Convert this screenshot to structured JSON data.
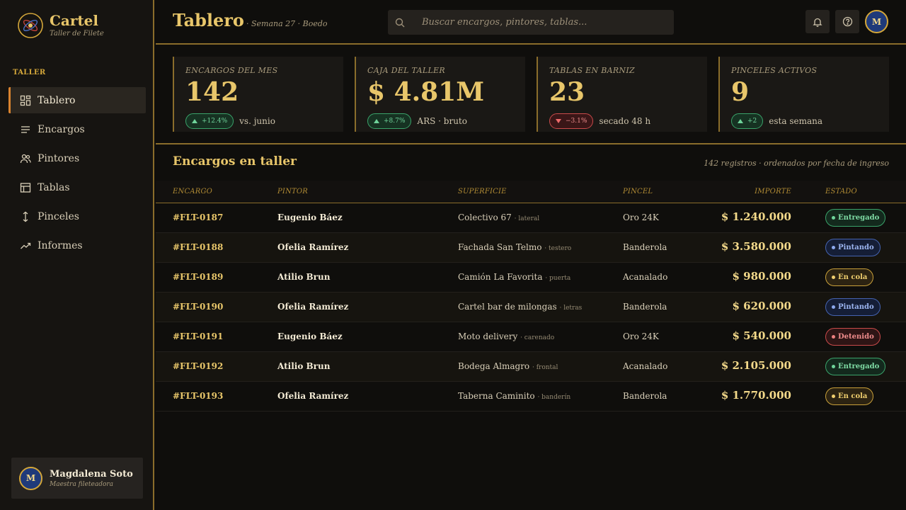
{
  "brand": {
    "name": "Cartel",
    "subtitle": "Taller de Filete"
  },
  "sidebar": {
    "section": "TALLER",
    "items": [
      {
        "label": "Tablero",
        "icon": "dashboard-icon",
        "active": true
      },
      {
        "label": "Encargos",
        "icon": "list-icon"
      },
      {
        "label": "Pintores",
        "icon": "users-icon"
      },
      {
        "label": "Tablas",
        "icon": "table-icon"
      },
      {
        "label": "Pinceles",
        "icon": "brush-icon"
      },
      {
        "label": "Informes",
        "icon": "trend-icon"
      }
    ],
    "user": {
      "initial": "M",
      "name": "Magdalena Soto",
      "role": "Maestra fileteadora"
    }
  },
  "header": {
    "title": "Tablero",
    "subtitle": "· Semana 27 · Boedo",
    "search_placeholder": "Buscar encargos, pintores, tablas...",
    "avatar_initial": "M"
  },
  "kpis": [
    {
      "label": "ENCARGOS DEL MES",
      "value": "142",
      "delta": "+12.4%",
      "direction": "up",
      "note": "vs. junio"
    },
    {
      "label": "CAJA DEL TALLER",
      "value": "$ 4.81M",
      "delta": "+8.7%",
      "direction": "up",
      "note": "ARS · bruto"
    },
    {
      "label": "TABLAS EN BARNIZ",
      "value": "23",
      "delta": "−3.1%",
      "direction": "down",
      "note": "secado 48 h"
    },
    {
      "label": "PINCELES ACTIVOS",
      "value": "9",
      "delta": "+2",
      "direction": "up",
      "note": "esta semana"
    }
  ],
  "table": {
    "title": "Encargos en taller",
    "meta": "142 registros · ordenados por fecha de ingreso",
    "columns": [
      "ENCARGO",
      "PINTOR",
      "SUPERFICIE",
      "PINCEL",
      "IMPORTE",
      "ESTADO"
    ],
    "rows": [
      {
        "id": "#FLT-0187",
        "painter": "Eugenio Báez",
        "surface": "Colectivo 67",
        "detail": "· lateral",
        "brush": "Oro 24K",
        "amount": "$ 1.240.000",
        "status": "Entregado",
        "status_kind": "ent"
      },
      {
        "id": "#FLT-0188",
        "painter": "Ofelia Ramírez",
        "surface": "Fachada San Telmo",
        "detail": "· testero",
        "brush": "Banderola",
        "amount": "$ 3.580.000",
        "status": "Pintando",
        "status_kind": "pin"
      },
      {
        "id": "#FLT-0189",
        "painter": "Atilio Brun",
        "surface": "Camión La Favorita",
        "detail": "· puerta",
        "brush": "Acanalado",
        "amount": "$ 980.000",
        "status": "En cola",
        "status_kind": "col"
      },
      {
        "id": "#FLT-0190",
        "painter": "Ofelia Ramírez",
        "surface": "Cartel bar de milongas",
        "detail": "· letras",
        "brush": "Banderola",
        "amount": "$ 620.000",
        "status": "Pintando",
        "status_kind": "pin"
      },
      {
        "id": "#FLT-0191",
        "painter": "Eugenio Báez",
        "surface": "Moto delivery",
        "detail": "· carenado",
        "brush": "Oro 24K",
        "amount": "$ 540.000",
        "status": "Detenido",
        "status_kind": "det"
      },
      {
        "id": "#FLT-0192",
        "painter": "Atilio Brun",
        "surface": "Bodega Almagro",
        "detail": "· frontal",
        "brush": "Acanalado",
        "amount": "$ 2.105.000",
        "status": "Entregado",
        "status_kind": "ent"
      },
      {
        "id": "#FLT-0193",
        "painter": "Ofelia Ramírez",
        "surface": "Taberna Caminito",
        "detail": "· banderín",
        "brush": "Banderola",
        "amount": "$ 1.770.000",
        "status": "En cola",
        "status_kind": "col"
      }
    ]
  }
}
